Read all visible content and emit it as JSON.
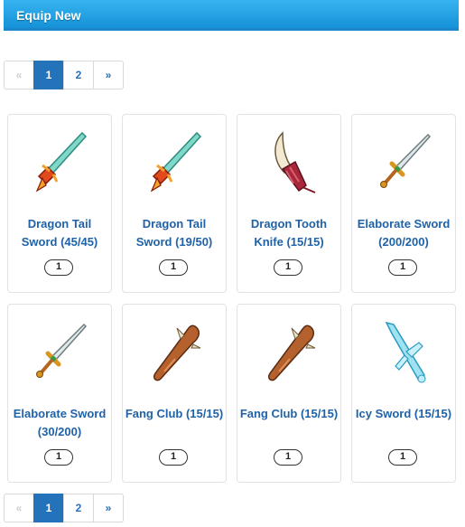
{
  "header": {
    "title": "Equip New"
  },
  "pagination": {
    "prev": "«",
    "pages": [
      "1",
      "2"
    ],
    "next": "»",
    "current": "1"
  },
  "items": [
    {
      "name": "Dragon Tail Sword (45/45)",
      "qty": "1",
      "icon": "dragon-tail-sword-icon"
    },
    {
      "name": "Dragon Tail Sword (19/50)",
      "qty": "1",
      "icon": "dragon-tail-sword-icon"
    },
    {
      "name": "Dragon Tooth Knife (15/15)",
      "qty": "1",
      "icon": "dragon-tooth-knife-icon"
    },
    {
      "name": "Elaborate Sword (200/200)",
      "qty": "1",
      "icon": "elaborate-sword-icon"
    },
    {
      "name": "Elaborate Sword (30/200)",
      "qty": "1",
      "icon": "elaborate-sword-icon"
    },
    {
      "name": "Fang Club (15/15)",
      "qty": "1",
      "icon": "fang-club-icon"
    },
    {
      "name": "Fang Club (15/15)",
      "qty": "1",
      "icon": "fang-club-icon"
    },
    {
      "name": "Icy Sword (15/15)",
      "qty": "1",
      "icon": "icy-sword-icon"
    }
  ]
}
